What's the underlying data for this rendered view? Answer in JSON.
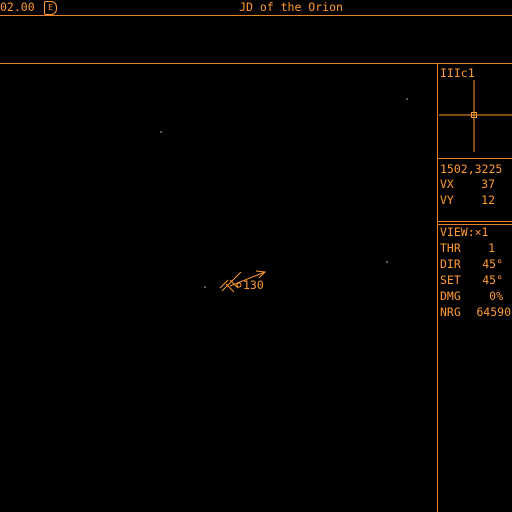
{
  "header": {
    "credits": "02.00",
    "credits_button_label": "E",
    "title": "JD of the Orion"
  },
  "scanner": {
    "sector_label": "IIIc1"
  },
  "position": {
    "coords": "1502,3225",
    "vx_label": "VX",
    "vx_value": "37",
    "vy_label": "VY",
    "vy_value": "12"
  },
  "status": {
    "view": "VIEW:×1",
    "thr_label": "THR",
    "thr_value": "1",
    "dir_label": "DIR",
    "dir_value": "45°",
    "set_label": "SET",
    "set_value": "45°",
    "dmg_label": "DMG",
    "dmg_value": "0%",
    "nrg_label": "NRG",
    "nrg_value": "64590"
  },
  "space": {
    "target_label": "130"
  },
  "colors": {
    "accent": "#ff9a32",
    "background": "#000000"
  }
}
